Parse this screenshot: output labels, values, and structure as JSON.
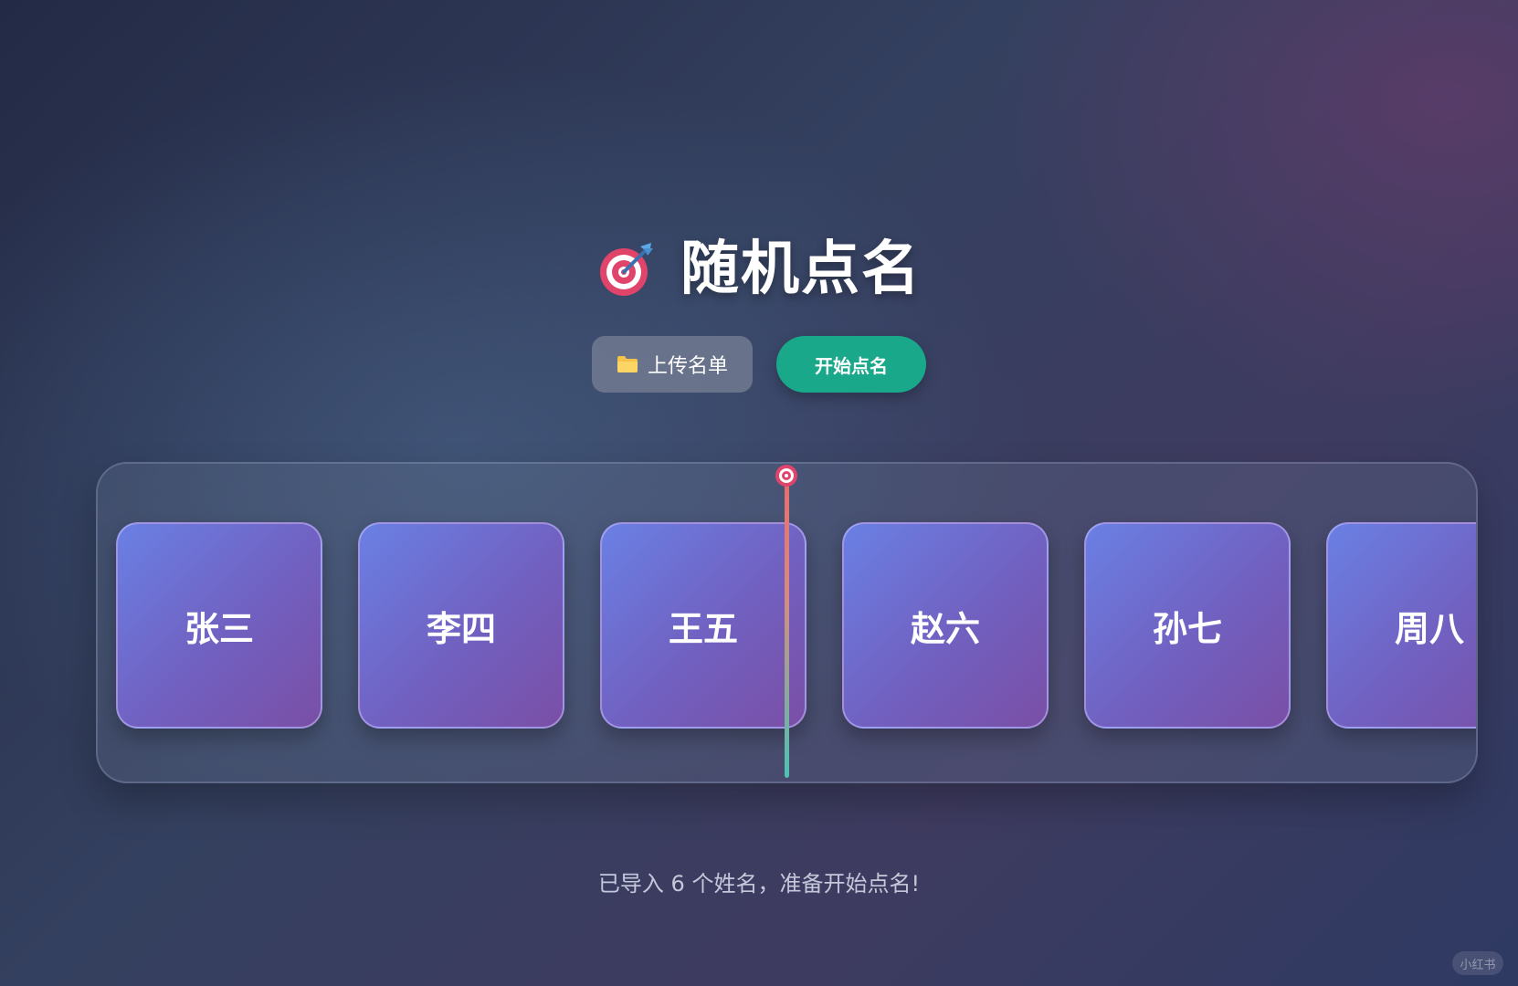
{
  "app": {
    "title": "随机点名",
    "title_icon": "target-dart-icon"
  },
  "toolbar": {
    "upload_label": "上传名单",
    "upload_icon": "folder-icon",
    "start_label": "开始点名"
  },
  "names": [
    "张三",
    "李四",
    "王五",
    "赵六",
    "孙七",
    "周八"
  ],
  "status": "已导入 6 个姓名，准备开始点名!",
  "watermark": "小红书",
  "colors": {
    "start_button": "#1aa88a",
    "card_gradient_start": "#6a80e4",
    "card_gradient_end": "#7a4fa6",
    "pointer_top": "#e96a6a",
    "pointer_bottom": "#4cc3b3"
  }
}
